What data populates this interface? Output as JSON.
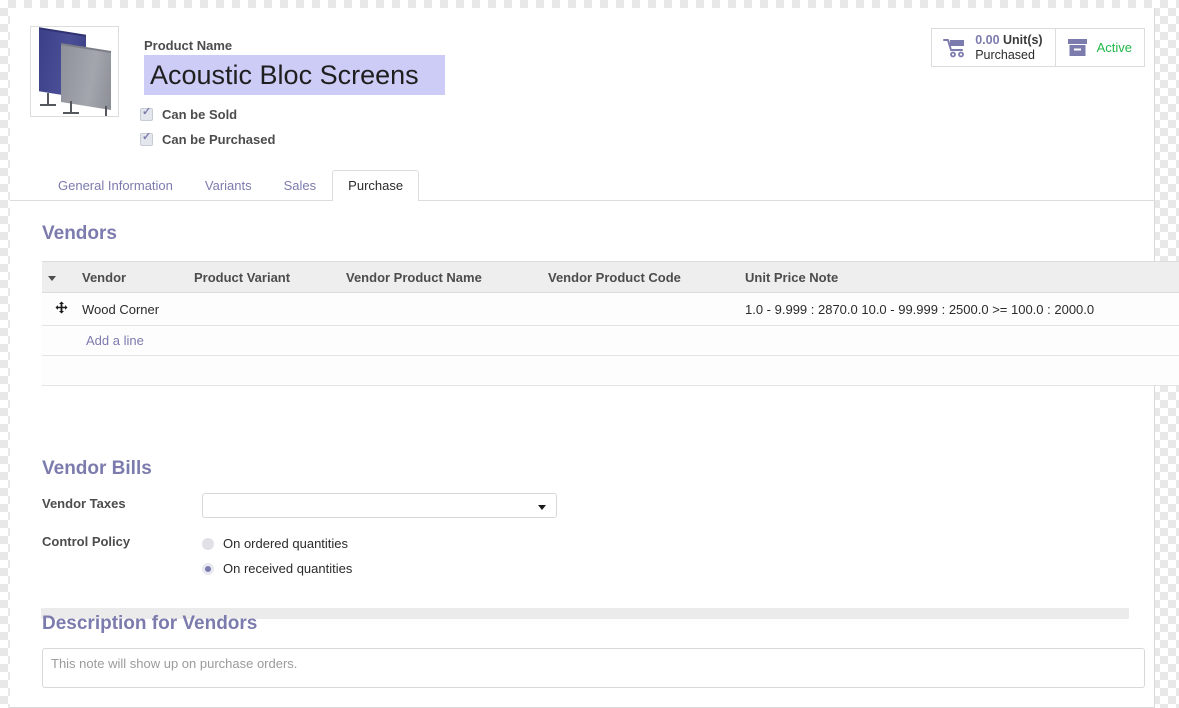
{
  "product": {
    "image_alt": "acoustic-screens-thumbnail",
    "name_label": "Product Name",
    "name_value": "Acoustic Bloc Screens",
    "can_be_sold_label": "Can be Sold",
    "can_be_purchased_label": "Can be Purchased",
    "can_be_sold_checked": true,
    "can_be_purchased_checked": true
  },
  "stat_buttons": {
    "purchased": {
      "icon": "shopping-cart-icon",
      "value": "0.00",
      "unit": "Unit(s)",
      "caption": "Purchased"
    },
    "archive": {
      "icon": "box-archive-icon",
      "label": "Active",
      "color": "#22b84a"
    }
  },
  "tabs": [
    {
      "label": "General Information",
      "active": false
    },
    {
      "label": "Variants",
      "active": false
    },
    {
      "label": "Sales",
      "active": false
    },
    {
      "label": "Purchase",
      "active": true
    }
  ],
  "vendors": {
    "title": "Vendors",
    "columns": [
      "Vendor",
      "Product Variant",
      "Vendor Product Name",
      "Vendor Product Code",
      "Unit Price Note"
    ],
    "rows": [
      {
        "vendor": "Wood Corner",
        "product_variant": "",
        "vendor_product_name": "",
        "vendor_product_code": "",
        "unit_price_note": "1.0 - 9.999 : 2870.0 10.0 - 99.999 : 2500.0 >= 100.0 : 2000.0"
      }
    ],
    "add_line_label": "Add a line",
    "row_handle_icon": "drag-move-icon",
    "row_delete_icon": "trash-icon",
    "sort_icon": "sort-descending-caret-icon"
  },
  "vendor_bills": {
    "title": "Vendor Bills",
    "vendor_taxes_label": "Vendor Taxes",
    "vendor_taxes_value": "",
    "control_policy_label": "Control Policy",
    "control_policy_options": [
      {
        "label": "On ordered quantities",
        "selected": false
      },
      {
        "label": "On received quantities",
        "selected": true
      }
    ]
  },
  "description": {
    "title": "Description for Vendors",
    "value": "",
    "placeholder": "This note will show up on purchase orders."
  },
  "colors": {
    "accent": "#7c7bad",
    "active_green": "#22b84a",
    "selection": "#ccccf7",
    "header_bg": "#eeeeee"
  }
}
